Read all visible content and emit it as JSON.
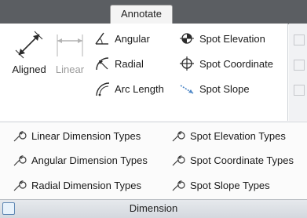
{
  "ribbon": {
    "tab_label": "Annotate",
    "panel_title": "Dimension"
  },
  "big_buttons": [
    {
      "label": "Aligned",
      "icon": "aligned-dimension-icon",
      "enabled": true
    },
    {
      "label": "Linear",
      "icon": "linear-dimension-icon",
      "enabled": false
    }
  ],
  "small_buttons_col1": [
    {
      "label": "Angular",
      "icon": "angular-dimension-icon"
    },
    {
      "label": "Radial",
      "icon": "radial-dimension-icon"
    },
    {
      "label": "Arc Length",
      "icon": "arc-length-icon"
    }
  ],
  "small_buttons_col2": [
    {
      "label": "Spot Elevation",
      "icon": "spot-elevation-icon"
    },
    {
      "label": "Spot Coordinate",
      "icon": "spot-coordinate-icon"
    },
    {
      "label": "Spot Slope",
      "icon": "spot-slope-icon"
    }
  ],
  "types_col1": [
    {
      "label": "Linear Dimension Types",
      "icon": "wrench-icon"
    },
    {
      "label": "Angular Dimension Types",
      "icon": "wrench-icon"
    },
    {
      "label": "Radial Dimension Types",
      "icon": "wrench-icon"
    }
  ],
  "types_col2": [
    {
      "label": "Spot Elevation Types",
      "icon": "wrench-icon"
    },
    {
      "label": "Spot Coordinate Types",
      "icon": "wrench-icon"
    },
    {
      "label": "Spot Slope Types",
      "icon": "wrench-icon"
    }
  ],
  "colors": {
    "topbar": "#5b5e62",
    "accent_blue": "#3a6ea5",
    "disabled_text": "#9b9b9b"
  }
}
